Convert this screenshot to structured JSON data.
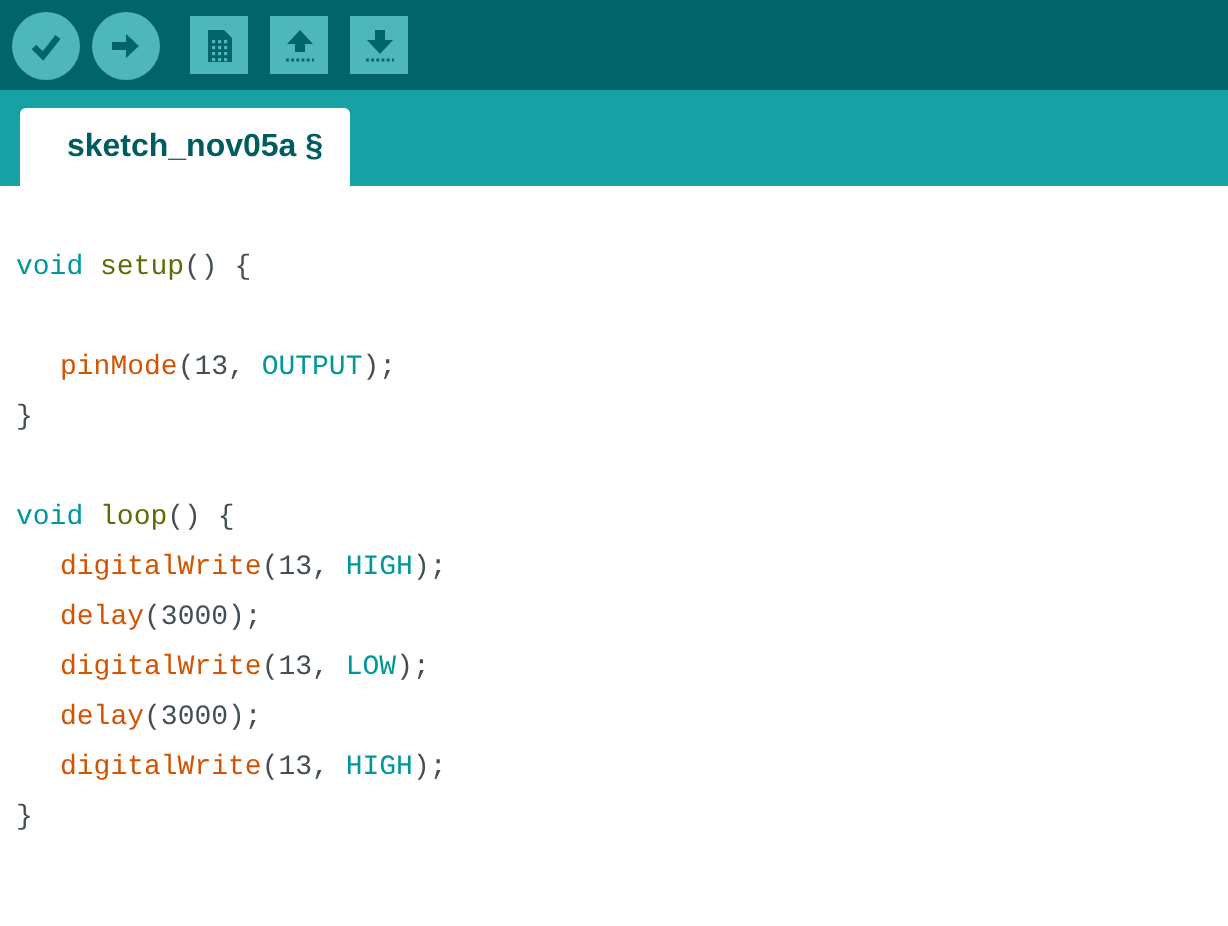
{
  "toolbar": {
    "buttons": [
      {
        "kind": "verify"
      },
      {
        "kind": "upload"
      },
      {
        "kind": "new"
      },
      {
        "kind": "open"
      },
      {
        "kind": "save"
      }
    ]
  },
  "tabs": [
    {
      "label": "sketch_nov05a §",
      "selected": true
    }
  ],
  "editor": {
    "lines": [
      {
        "kind": "code",
        "indented": false,
        "tokens": [
          {
            "text": "void ",
            "kind": "keyword"
          },
          {
            "text": "setup",
            "kind": "entry"
          },
          {
            "text": "() {",
            "kind": "plain"
          }
        ]
      },
      {
        "kind": "blank"
      },
      {
        "kind": "code",
        "indented": true,
        "tokens": [
          {
            "text": "pinMode",
            "kind": "function"
          },
          {
            "text": "(13, ",
            "kind": "plain"
          },
          {
            "text": "OUTPUT",
            "kind": "constant"
          },
          {
            "text": ");",
            "kind": "plain"
          }
        ]
      },
      {
        "kind": "code",
        "indented": false,
        "tokens": [
          {
            "text": "}",
            "kind": "plain"
          }
        ]
      },
      {
        "kind": "blank"
      },
      {
        "kind": "code",
        "indented": false,
        "tokens": [
          {
            "text": "void ",
            "kind": "keyword"
          },
          {
            "text": "loop",
            "kind": "entry"
          },
          {
            "text": "() {",
            "kind": "plain"
          }
        ]
      },
      {
        "kind": "code",
        "indented": true,
        "tokens": [
          {
            "text": "digitalWrite",
            "kind": "function"
          },
          {
            "text": "(13, ",
            "kind": "plain"
          },
          {
            "text": "HIGH",
            "kind": "constant"
          },
          {
            "text": ");",
            "kind": "plain"
          }
        ]
      },
      {
        "kind": "code",
        "indented": true,
        "tokens": [
          {
            "text": "delay",
            "kind": "function"
          },
          {
            "text": "(3000);",
            "kind": "plain"
          }
        ]
      },
      {
        "kind": "code",
        "indented": true,
        "tokens": [
          {
            "text": "digitalWrite",
            "kind": "function"
          },
          {
            "text": "(13, ",
            "kind": "plain"
          },
          {
            "text": "LOW",
            "kind": "constant"
          },
          {
            "text": ");",
            "kind": "plain"
          }
        ]
      },
      {
        "kind": "code",
        "indented": true,
        "tokens": [
          {
            "text": "delay",
            "kind": "function"
          },
          {
            "text": "(3000);",
            "kind": "plain"
          }
        ]
      },
      {
        "kind": "code",
        "indented": true,
        "tokens": [
          {
            "text": "digitalWrite",
            "kind": "function"
          },
          {
            "text": "(13, ",
            "kind": "plain"
          },
          {
            "text": "HIGH",
            "kind": "constant"
          },
          {
            "text": ");",
            "kind": "plain"
          }
        ]
      },
      {
        "kind": "code",
        "indented": false,
        "tokens": [
          {
            "text": "}",
            "kind": "plain"
          }
        ]
      }
    ]
  }
}
